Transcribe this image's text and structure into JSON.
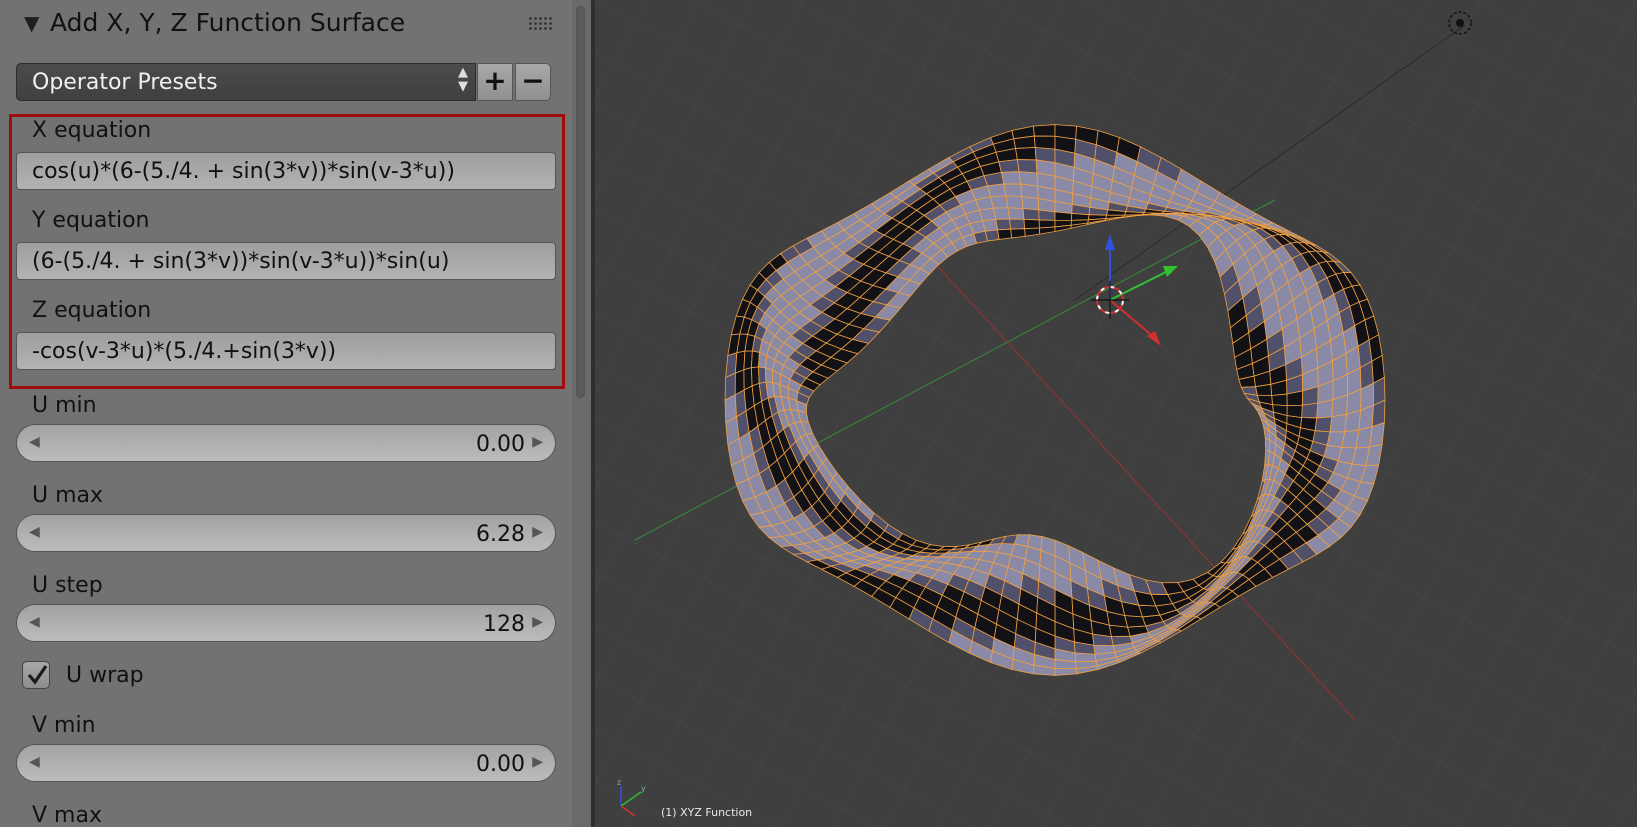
{
  "panel": {
    "title": "Add X, Y, Z Function Surface",
    "presets_label": "Operator Presets",
    "add_preset": "+",
    "remove_preset": "−",
    "fields": [
      {
        "label": "X equation",
        "value": "cos(u)*(6-(5./4. + sin(3*v))*sin(v-3*u))"
      },
      {
        "label": "Y equation",
        "value": "(6-(5./4. + sin(3*v))*sin(v-3*u))*sin(u)"
      },
      {
        "label": "Z equation",
        "value": "-cos(v-3*u)*(5./4.+sin(3*v))"
      }
    ],
    "sliders": [
      {
        "label": "U min",
        "value": "0.00"
      },
      {
        "label": "U max",
        "value": "6.28"
      },
      {
        "label": "U step",
        "value": "128"
      },
      {
        "label": "V min",
        "value": "0.00"
      },
      {
        "label": "V max",
        "value": ""
      }
    ],
    "u_wrap": {
      "label": "U wrap",
      "checked": true
    }
  },
  "viewport": {
    "object_label": "(1) XYZ Function",
    "mesh_color": "#8a8aa6",
    "wire_color": "#f0a040",
    "axis_colors": {
      "x": "#d03030",
      "y": "#30c030",
      "z": "#3050e0"
    }
  }
}
